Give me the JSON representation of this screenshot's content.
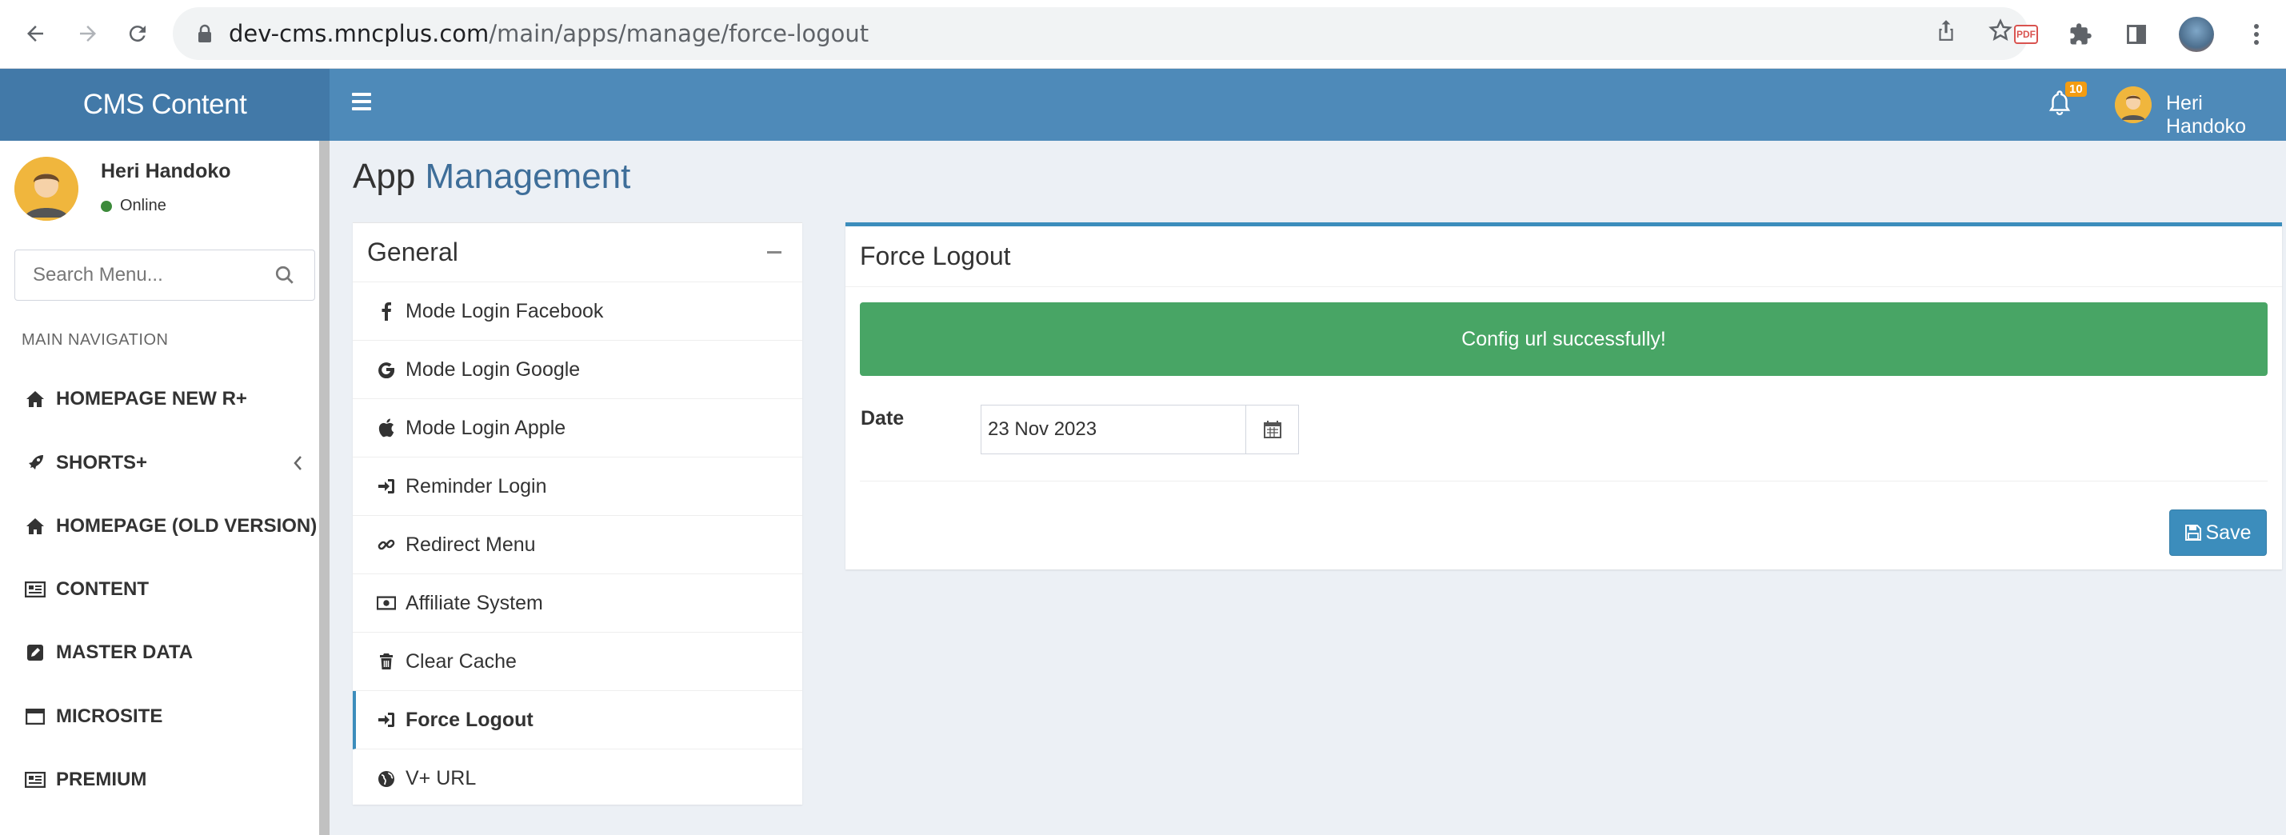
{
  "browser": {
    "url_host": "dev-cms.mncplus.com",
    "url_path": "/main/apps/manage/force-logout"
  },
  "header": {
    "logo": "CMS Content",
    "notification_count": "10",
    "user_name": "Heri Handoko",
    "colors": {
      "header_bg": "#4e8ab9",
      "logo_bg": "#4279a8",
      "badge": "#f39c12"
    }
  },
  "sidebar": {
    "user_name": "Heri Handoko",
    "user_status": "Online",
    "search_placeholder": "Search Menu...",
    "nav_header": "MAIN NAVIGATION",
    "items": [
      {
        "label": "HOMEPAGE NEW R+",
        "icon": "home-icon"
      },
      {
        "label": "SHORTS+",
        "icon": "rocket-icon",
        "has_submenu": true
      },
      {
        "label": "HOMEPAGE (OLD VERSION)",
        "icon": "home-icon"
      },
      {
        "label": "CONTENT",
        "icon": "newspaper-icon"
      },
      {
        "label": "MASTER DATA",
        "icon": "edit-icon"
      },
      {
        "label": "MICROSITE",
        "icon": "window-icon"
      },
      {
        "label": "PREMIUM",
        "icon": "newspaper-icon"
      }
    ]
  },
  "page": {
    "title": "App",
    "subtitle": "Management"
  },
  "general_box": {
    "title": "General",
    "items": [
      {
        "label": "Mode Login Facebook",
        "icon": "facebook-icon"
      },
      {
        "label": "Mode Login Google",
        "icon": "google-icon"
      },
      {
        "label": "Mode Login Apple",
        "icon": "apple-icon"
      },
      {
        "label": "Reminder Login",
        "icon": "sign-in-icon"
      },
      {
        "label": "Redirect Menu",
        "icon": "link-icon"
      },
      {
        "label": "Affiliate System",
        "icon": "money-icon"
      },
      {
        "label": "Clear Cache",
        "icon": "trash-icon"
      },
      {
        "label": "Force Logout",
        "icon": "sign-out-icon",
        "active": true
      },
      {
        "label": "V+ URL",
        "icon": "globe-icon"
      }
    ]
  },
  "force_logout": {
    "title": "Force Logout",
    "alert": "Config url successfully!",
    "date_label": "Date",
    "date_value": "23 Nov 2023",
    "save_label": "Save",
    "colors": {
      "alert_bg": "#48a565",
      "primary": "#3c8dbc"
    }
  }
}
